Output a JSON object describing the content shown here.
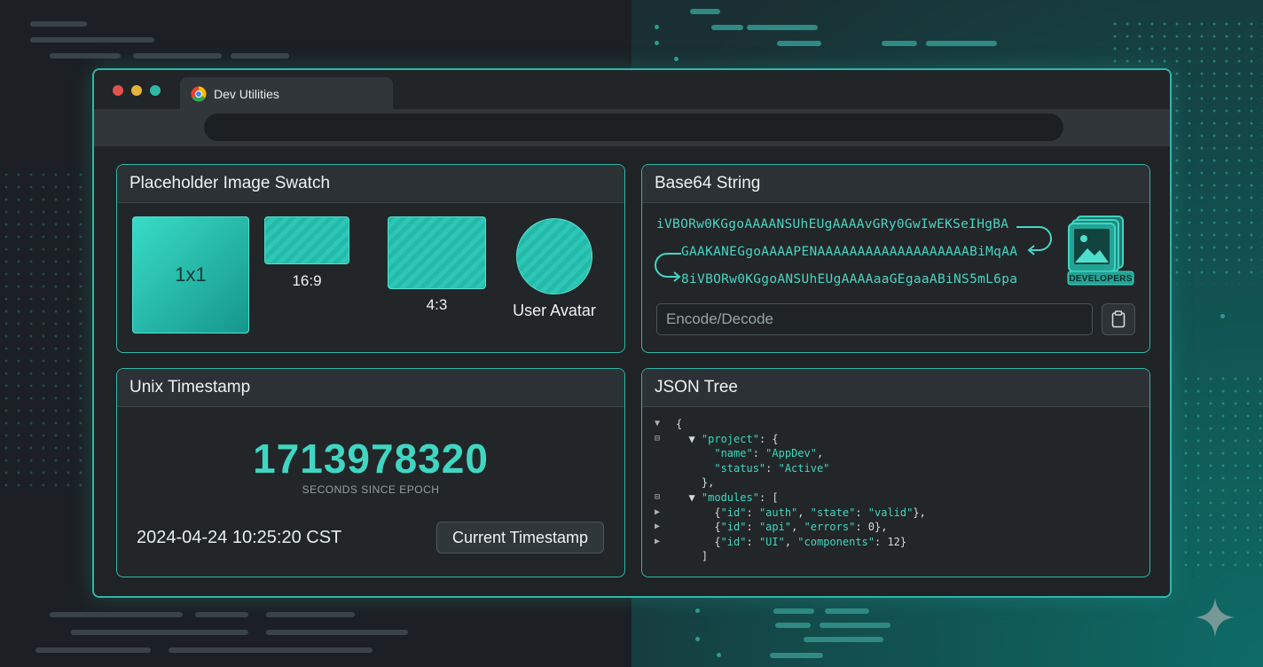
{
  "browser": {
    "tab_title": "Dev Utilities",
    "traffic_colors": [
      "#e2524b",
      "#e6b23a",
      "#2fb7a8"
    ]
  },
  "swatch_panel": {
    "title": "Placeholder Image Swatch",
    "items": [
      {
        "label": "1x1"
      },
      {
        "label": "16:9"
      },
      {
        "label": "4:3"
      },
      {
        "label": "User Avatar"
      }
    ]
  },
  "base64_panel": {
    "title": "Base64 String",
    "lines": [
      "iVBORw0KGgoAAAANSUhEUgAAAAvGRy0GwIwEKSeIHgBA",
      "GAAKANEGgoAAAAPENAAAAAAAAAAAAAAAAAAABiMqAA",
      "8iVBORw0KGgoANSUhEUgAAAAaaGEgaaABiNS5mL6pa"
    ],
    "badge": "DEVELOPERS",
    "input_placeholder": "Encode/Decode",
    "copy_icon": "clipboard-icon"
  },
  "timestamp_panel": {
    "title": "Unix Timestamp",
    "value": "1713978320",
    "caption": "SECONDS SINCE EPOCH",
    "datetime": "2024-04-24 10:25:20 CST",
    "button_label": "Current Timestamp"
  },
  "json_panel": {
    "title": "JSON Tree",
    "lines": [
      {
        "control": "▼",
        "text": "{"
      },
      {
        "control": "⊟",
        "text": "  ▼ \"project\": {"
      },
      {
        "control": "",
        "text": "      \"name\": \"AppDev\","
      },
      {
        "control": "",
        "text": "      \"status\": \"Active\""
      },
      {
        "control": "",
        "text": "    },"
      },
      {
        "control": "⊟",
        "text": "  ▼ \"modules\": ["
      },
      {
        "control": "▶",
        "text": "      {\"id\": \"auth\", \"state\": \"valid\"},"
      },
      {
        "control": "▶",
        "text": "      {\"id\": \"api\", \"errors\": 0},"
      },
      {
        "control": "▶",
        "text": "      {\"id\": \"UI\", \"components\": 12}"
      },
      {
        "control": "",
        "text": "    ]"
      }
    ]
  },
  "colors": {
    "accent": "#2fb7a8",
    "accent_text": "#3fd6c2"
  }
}
